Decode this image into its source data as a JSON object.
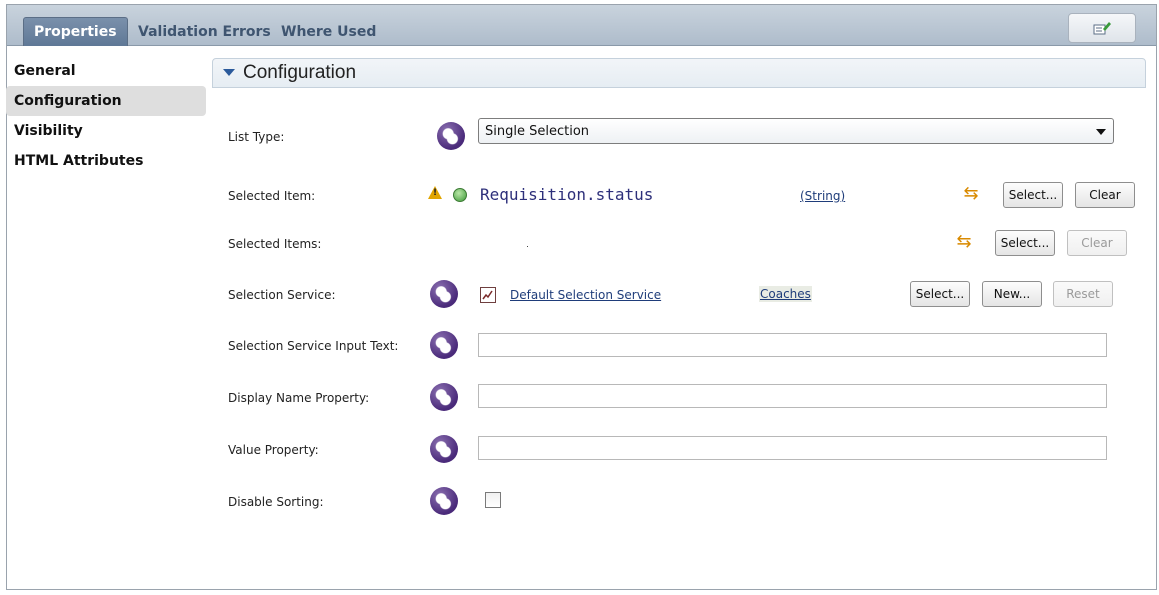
{
  "tabs": [
    {
      "label": "Properties"
    },
    {
      "label": "Validation Errors"
    },
    {
      "label": "Where Used"
    }
  ],
  "nav": {
    "items": [
      {
        "label": "General"
      },
      {
        "label": "Configuration"
      },
      {
        "label": "Visibility"
      },
      {
        "label": "HTML Attributes"
      }
    ]
  },
  "section": {
    "title": "Configuration"
  },
  "form": {
    "list_type": {
      "label": "List Type:",
      "value": "Single Selection"
    },
    "selected_item": {
      "label": "Selected Item:",
      "binding": "Requisition.status",
      "type": "(String)",
      "select_label": "Select...",
      "clear_label": "Clear"
    },
    "selected_items": {
      "label": "Selected Items:",
      "binding": ".",
      "select_label": "Select...",
      "clear_label": "Clear"
    },
    "selection_service": {
      "label": "Selection Service:",
      "service_name": "Default Selection Service",
      "toolkit": "Coaches",
      "select_label": "Select...",
      "new_label": "New...",
      "reset_label": "Reset"
    },
    "selection_service_input_text": {
      "label": "Selection Service Input Text:",
      "value": ""
    },
    "display_name_property": {
      "label": "Display Name Property:",
      "value": ""
    },
    "value_property": {
      "label": "Value Property:",
      "value": ""
    },
    "disable_sorting": {
      "label": "Disable Sorting:",
      "checked": false
    }
  },
  "icons": {
    "binding": "variable-binding-icon",
    "warning": "warning-icon",
    "status": "green-status-icon",
    "swap": "swap-binding-icon",
    "service": "service-icon",
    "edit": "edit-icon"
  },
  "colors": {
    "tab_active": "#6f86a3",
    "header_bg": "#b8c6d4",
    "link": "#1f3d7a",
    "binding_icon": "#4a2a7a"
  }
}
